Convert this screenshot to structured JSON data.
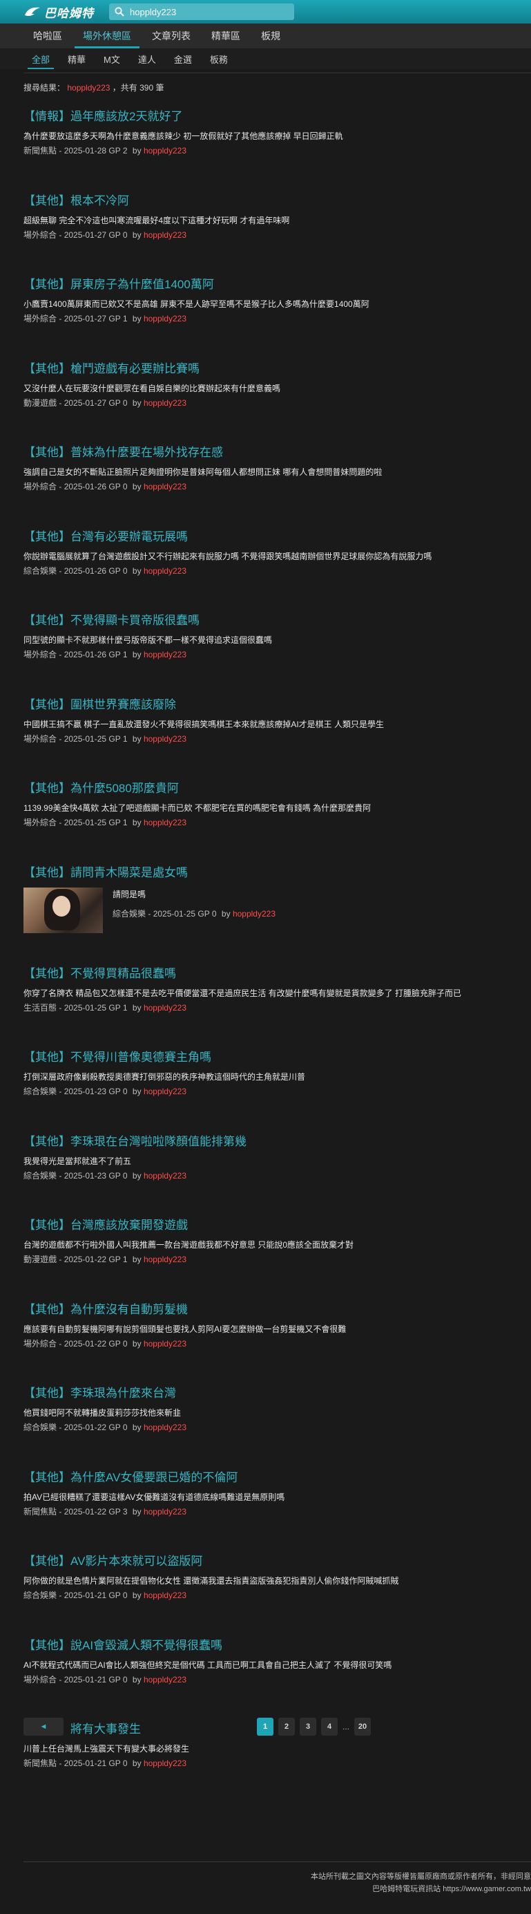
{
  "header": {
    "logo_text": "巴哈姆特",
    "search_value": "hoppldy223"
  },
  "main_nav": [
    {
      "label": "哈啦區",
      "active": false
    },
    {
      "label": "場外休憩區",
      "active": true
    },
    {
      "label": "文章列表",
      "active": false
    },
    {
      "label": "精華區",
      "active": false
    },
    {
      "label": "板規",
      "active": false
    }
  ],
  "sub_tabs": [
    {
      "label": "全部",
      "active": true
    },
    {
      "label": "精華",
      "active": false
    },
    {
      "label": "M文",
      "active": false
    },
    {
      "label": "達人",
      "active": false
    },
    {
      "label": "金選",
      "active": false
    },
    {
      "label": "板務",
      "active": false
    }
  ],
  "result_line": {
    "prefix": "搜尋結果：",
    "keyword": "hoppldy223",
    "suffix": "，共有 390 筆"
  },
  "results": [
    {
      "title": "【情報】過年應該放2天就好了",
      "excerpt": "為什麼要放這麼多天啊為什麼意義應該辣少 初一放假就好了其他應該療掉 早日回歸正軌",
      "board": "新聞焦點",
      "date": "2025-01-28",
      "gp": "GP 2",
      "by": "by",
      "author": "hoppldy223"
    },
    {
      "title": "【其他】根本不冷阿",
      "excerpt": "超級無聊 完全不冷這也叫寒流喔最好4度以下這種才好玩啊 才有過年味啊",
      "board": "場外綜合",
      "date": "2025-01-27",
      "gp": "GP 0",
      "by": "by",
      "author": "hoppldy223"
    },
    {
      "title": "【其他】屏東房子為什麼值1400萬阿",
      "excerpt": "小鷹賣1400萬屏東而已欸又不是高雄 屏東不是人跡罕至嗎不是猴子比人多嗎為什麼要1400萬阿",
      "board": "場外綜合",
      "date": "2025-01-27",
      "gp": "GP 1",
      "by": "by",
      "author": "hoppldy223"
    },
    {
      "title": "【其他】槍鬥遊戲有必要辦比賽嗎",
      "excerpt": "又沒什麼人在玩要沒什麼觀眾在看自娛自樂的比賽辦起來有什麼意義嗎",
      "board": "動漫遊戲",
      "date": "2025-01-27",
      "gp": "GP 0",
      "by": "by",
      "author": "hoppldy223"
    },
    {
      "title": "【其他】普妹為什麼要在場外找存在感",
      "excerpt": "強調自己是女的不斷貼正臉照片足夠證明你是普妹阿每個人都想問正妹 哪有人會想問普妹問題的啦",
      "board": "場外綜合",
      "date": "2025-01-26",
      "gp": "GP 0",
      "by": "by",
      "author": "hoppldy223"
    },
    {
      "title": "【其他】台灣有必要辦電玩展嗎",
      "excerpt": "你說辦電腦展就算了台灣遊戲設計又不行辦起來有說服力嗎 不覺得跟笑嗎越南辦個世界足球展你認為有說服力嗎",
      "board": "綜合娛樂",
      "date": "2025-01-26",
      "gp": "GP 0",
      "by": "by",
      "author": "hoppldy223"
    },
    {
      "title": "【其他】不覺得顯卡買帝版很蠢嗎",
      "excerpt": "同型號的顯卡不就那樣什麼弓版帝版不都一樣不覺得追求這個很蠢嗎",
      "board": "場外綜合",
      "date": "2025-01-26",
      "gp": "GP 1",
      "by": "by",
      "author": "hoppldy223"
    },
    {
      "title": "【其他】圍棋世界賽應該廢除",
      "excerpt": "中國棋王搞不贏 棋子一直亂放還發火不覺得很搞笑嗎棋王本來就應該療掉AI才是棋王 人類只是學生",
      "board": "場外綜合",
      "date": "2025-01-25",
      "gp": "GP 1",
      "by": "by",
      "author": "hoppldy223"
    },
    {
      "title": "【其他】為什麼5080那麼貴阿",
      "excerpt": "1139.99美金快4萬欸 太扯了吧遊戲顯卡而已欸 不都肥宅在買的嗎肥宅會有錢嗎 為什麼那麼貴阿",
      "board": "場外綜合",
      "date": "2025-01-25",
      "gp": "GP 1",
      "by": "by",
      "author": "hoppldy223"
    },
    {
      "title": "【其他】請問青木陽菜是處女嗎",
      "excerpt": "請問是嗎",
      "board": "綜合娛樂",
      "date": "2025-01-25",
      "gp": "GP 0",
      "by": "by",
      "author": "hoppldy223",
      "thumbnail": true
    },
    {
      "title": "【其他】不覺得買精品很蠢嗎",
      "excerpt": "你穿了名牌衣 精品包又怎樣還不是去吃平價便當還不是過庶民生活 有改變什麼嗎有變就是貨款變多了 打腫臉充胖子而已",
      "board": "生活百態",
      "date": "2025-01-25",
      "gp": "GP 1",
      "by": "by",
      "author": "hoppldy223"
    },
    {
      "title": "【其他】不覺得川普像奧德賽主角嗎",
      "excerpt": "打倒深層政府像剿殺教授奧德賽打倒邪惡的秩序神教這個時代的主角就是川普",
      "board": "綜合娛樂",
      "date": "2025-01-23",
      "gp": "GP 0",
      "by": "by",
      "author": "hoppldy223"
    },
    {
      "title": "【其他】李珠珢在台灣啦啦隊顏值能排第幾",
      "excerpt": "我覺得光是當邦就進不了前五",
      "board": "綜合娛樂",
      "date": "2025-01-23",
      "gp": "GP 0",
      "by": "by",
      "author": "hoppldy223"
    },
    {
      "title": "【其他】台灣應該放棄開發遊戲",
      "excerpt": "台灣的遊戲都不行啦外國人叫我推薦一款台灣遊戲我都不好意思 只能說0應該全面放棄才對",
      "board": "動漫遊戲",
      "date": "2025-01-22",
      "gp": "GP 1",
      "by": "by",
      "author": "hoppldy223"
    },
    {
      "title": "【其他】為什麼沒有自動剪髮機",
      "excerpt": "應該要有自動剪髮機阿哪有說剪個頭髮也要找人剪阿AI要怎麼辦做一台剪髮機又不會很難",
      "board": "場外綜合",
      "date": "2025-01-22",
      "gp": "GP 0",
      "by": "by",
      "author": "hoppldy223"
    },
    {
      "title": "【其他】李珠珢為什麼來台灣",
      "excerpt": "他買錢吧阿不就轉播皮蛋莉莎莎找他來斬韭",
      "board": "綜合娛樂",
      "date": "2025-01-22",
      "gp": "GP 0",
      "by": "by",
      "author": "hoppldy223"
    },
    {
      "title": "【其他】為什麼AV女優要跟已婚的不倫阿",
      "excerpt": "拍AV已經很糟糕了還要這樣AV女優難道沒有道德底線嗎難道是無原則嗎",
      "board": "新聞焦點",
      "date": "2025-01-22",
      "gp": "GP 3",
      "by": "by",
      "author": "hoppldy223"
    },
    {
      "title": "【其他】AV影片本來就可以盜版阿",
      "excerpt": "阿你做的就是色情片業阿就在提倡物化女性 還徵滿我還去指責盜版強姦犯指責別人偷你錢作阿賊喊抓賊",
      "board": "綜合娛樂",
      "date": "2025-01-21",
      "gp": "GP 0",
      "by": "by",
      "author": "hoppldy223"
    },
    {
      "title": "【其他】說AI會毀滅人類不覺得很蠢嗎",
      "excerpt": "AI不就程式代碼而已AI會比人類強但終究是個代碼 工具而已啊工具會自己把主人滅了 不覺得很可笑嗎",
      "board": "場外綜合",
      "date": "2025-01-21",
      "gp": "GP 0",
      "by": "by",
      "author": "hoppldy223"
    },
    {
      "title": "【其他】將有大事發生",
      "excerpt": "川普上任台灣馬上強震天下有變大事必將發生",
      "board": "新聞焦點",
      "date": "2025-01-21",
      "gp": "GP 0",
      "by": "by",
      "author": "hoppldy223"
    }
  ],
  "pager": {
    "prev": "◄",
    "pages": [
      "1",
      "2",
      "3",
      "4"
    ],
    "ellipsis": "...",
    "last": "20",
    "current": "1"
  },
  "footer": {
    "line1": "本站所刊載之圖文內容等版權皆屬原廠商或原作者所有，非經同意",
    "line2": "巴哈姆特電玩資訊站 https://www.gamer.com.tw"
  },
  "colors": {
    "accent": "#1ea6b7",
    "title": "#35b5c4",
    "author": "#ff4c4c",
    "background": "#1a1a1a"
  }
}
